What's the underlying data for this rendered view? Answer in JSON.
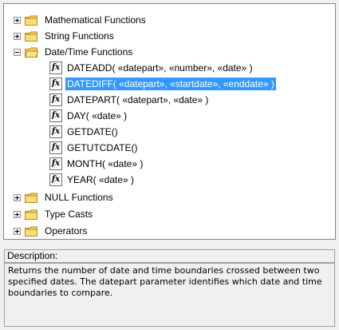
{
  "tree": {
    "items": [
      {
        "kind": "folder",
        "label": "Mathematical Functions",
        "expanded": false
      },
      {
        "kind": "folder",
        "label": "String Functions",
        "expanded": false
      },
      {
        "kind": "folder",
        "label": "Date/Time Functions",
        "expanded": true
      },
      {
        "kind": "function",
        "label": "DATEADD( «datepart», «number», «date» )"
      },
      {
        "kind": "function",
        "label": "DATEDIFF( «datepart», «startdate», «enddate» )",
        "selected": true
      },
      {
        "kind": "function",
        "label": "DATEPART( «datepart», «date» )"
      },
      {
        "kind": "function",
        "label": "DAY( «date» )"
      },
      {
        "kind": "function",
        "label": "GETDATE()"
      },
      {
        "kind": "function",
        "label": "GETUTCDATE()"
      },
      {
        "kind": "function",
        "label": "MONTH( «date» )"
      },
      {
        "kind": "function",
        "label": "YEAR( «date» )"
      },
      {
        "kind": "folder",
        "label": "NULL Functions",
        "expanded": false
      },
      {
        "kind": "folder",
        "label": "Type Casts",
        "expanded": false
      },
      {
        "kind": "folder",
        "label": "Operators",
        "expanded": false
      }
    ],
    "fx_icon_text": "fx",
    "selection_color": "#3399ff"
  },
  "description": {
    "title": "Description:",
    "text": "Returns the number of date and time boundaries crossed between two specified dates. The datepart parameter identifies which date and time boundaries to compare."
  },
  "icons": {
    "folder": "folder-icon",
    "function": "function-fx-icon",
    "expand": "expand-plus-icon",
    "collapse": "collapse-minus-icon"
  }
}
